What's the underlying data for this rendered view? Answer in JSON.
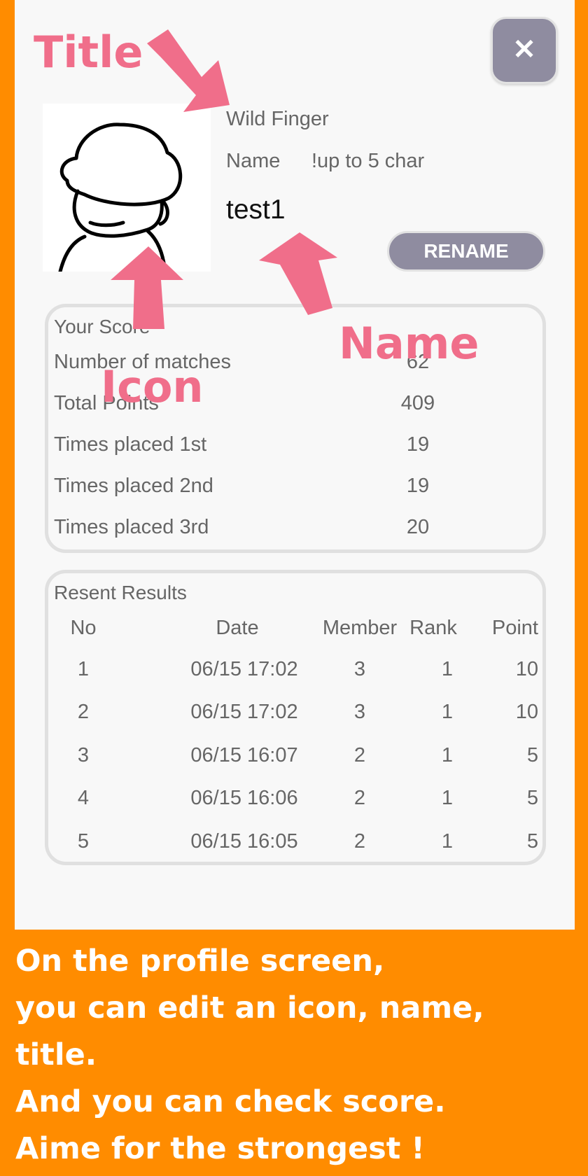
{
  "profile": {
    "close_label": "✕",
    "title": "Wild Finger",
    "name_label": "Name",
    "name_hint": "!up to 5 char",
    "name_value": "test1",
    "rename_label": "RENAME"
  },
  "score": {
    "heading": "Your Score",
    "rows": [
      {
        "label": "Number of matches",
        "value": "62"
      },
      {
        "label": "Total Points",
        "value": "409"
      },
      {
        "label": "Times placed 1st",
        "value": "19"
      },
      {
        "label": "Times placed 2nd",
        "value": "19"
      },
      {
        "label": "Times placed 3rd",
        "value": "20"
      }
    ]
  },
  "results": {
    "heading": "Resent Results",
    "columns": [
      "No",
      "Date",
      "Member",
      "Rank",
      "Point"
    ],
    "rows": [
      [
        "1",
        "06/15 17:02",
        "3",
        "1",
        "10"
      ],
      [
        "2",
        "06/15 17:02",
        "3",
        "1",
        "10"
      ],
      [
        "3",
        "06/15 16:07",
        "2",
        "1",
        "5"
      ],
      [
        "4",
        "06/15 16:06",
        "2",
        "1",
        "5"
      ],
      [
        "5",
        "06/15 16:05",
        "2",
        "1",
        "5"
      ]
    ]
  },
  "annotations": {
    "title": "Title",
    "icon": "Icon",
    "name": "Name",
    "color": "#f06e8a"
  },
  "caption": {
    "lines": [
      "On the profile screen,",
      "you can edit an icon, name,",
      "title.",
      "And you can check score.",
      "Aime for the strongest !"
    ]
  },
  "colors": {
    "background": "#ff8c00",
    "button": "#8f8ca0",
    "panel_border": "#e0e0e0"
  }
}
